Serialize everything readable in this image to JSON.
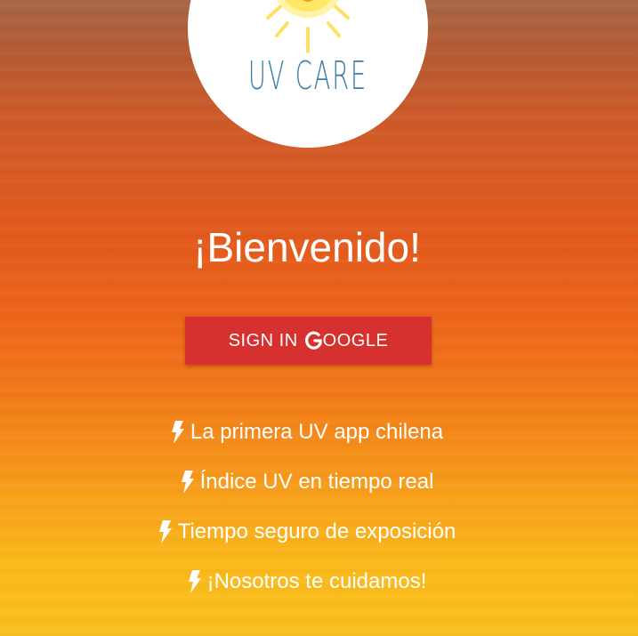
{
  "logo": {
    "text": "UV CARE",
    "icon": "sun-icon"
  },
  "welcome": {
    "title": "¡Bienvenido!"
  },
  "signin": {
    "label_prefix": "SIGN IN",
    "label_suffix": "OOGLE",
    "icon": "google-g-icon",
    "color": "#d7312f"
  },
  "features": {
    "icon": "lightning-bolt-icon",
    "items": [
      {
        "text": "La primera UV app chilena"
      },
      {
        "text": "Índice UV en tiempo real"
      },
      {
        "text": "Tiempo seguro de exposición"
      },
      {
        "text": "¡Nosotros te cuidamos!"
      }
    ]
  },
  "colors": {
    "text": "#ffffff",
    "logo_text": "#3b7fa8",
    "sun": "#ffe066"
  }
}
